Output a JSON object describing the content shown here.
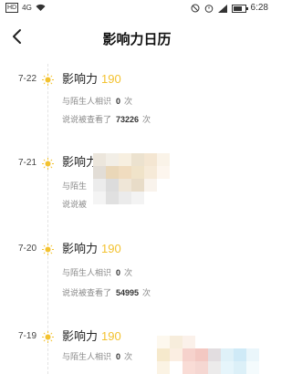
{
  "statusbar": {
    "network": "HD",
    "signal": "4G",
    "time": "6:28"
  },
  "header": {
    "title": "影响力日历",
    "back_icon": "chevron-left-icon"
  },
  "labels": {
    "influence": "影响力",
    "met_strangers": "与陌生人相识",
    "views": "说说被查看了",
    "unit": "次"
  },
  "colors": {
    "accent": "#f3c22f"
  },
  "entries": [
    {
      "date": "7-22",
      "score": "190",
      "met": "0",
      "views": "73226",
      "obscured": false
    },
    {
      "date": "7-21",
      "score": "",
      "met": "",
      "views": "",
      "obscured": true,
      "partial_texts": [
        "影响力",
        "与陌生",
        "说说被"
      ]
    },
    {
      "date": "7-20",
      "score": "190",
      "met": "0",
      "views": "54995",
      "obscured": false
    },
    {
      "date": "7-19",
      "score": "190",
      "met": "0",
      "views": "",
      "obscured": false
    }
  ]
}
